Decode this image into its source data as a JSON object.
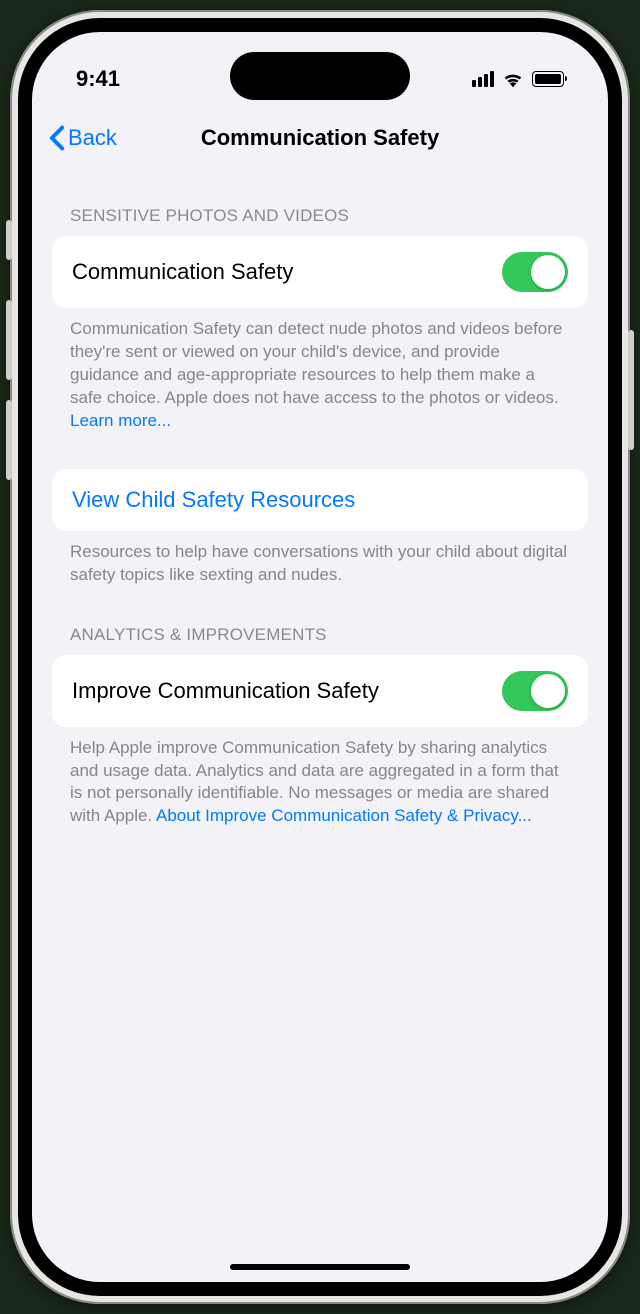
{
  "status": {
    "time": "9:41"
  },
  "nav": {
    "back_label": "Back",
    "title": "Communication Safety"
  },
  "section1": {
    "header": "SENSITIVE PHOTOS AND VIDEOS",
    "toggle_label": "Communication Safety",
    "toggle_on": true,
    "footer_text": "Communication Safety can detect nude photos and videos before they're sent or viewed on your child's device, and provide guidance and age-appropriate resources to help them make a safe choice. Apple does not have access to the photos or videos. ",
    "footer_link": "Learn more..."
  },
  "section2": {
    "link_label": "View Child Safety Resources",
    "footer_text": "Resources to help have conversations with your child about digital safety topics like sexting and nudes."
  },
  "section3": {
    "header": "ANALYTICS & IMPROVEMENTS",
    "toggle_label": "Improve Communication Safety",
    "toggle_on": true,
    "footer_text": "Help Apple improve Communication Safety by sharing analytics and usage data. Analytics and data are aggregated in a form that is not personally identifiable. No messages or media are shared with Apple. ",
    "footer_link": "About Improve Communication Safety & Privacy..."
  }
}
